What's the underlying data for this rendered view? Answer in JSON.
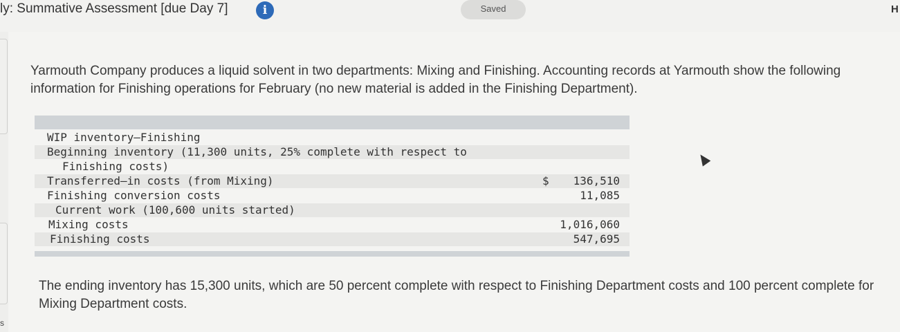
{
  "header": {
    "title": "ly: Summative Assessment [due Day 7]",
    "info_icon": "info-circle-icon",
    "saved_label": "Saved",
    "corner_letter": "H"
  },
  "sidebar": {
    "bottom_letter": "s"
  },
  "problem": {
    "intro": "Yarmouth Company produces a liquid solvent in two departments: Mixing and Finishing. Accounting records at Yarmouth show the following information for Finishing operations for February (no new material is added in the Finishing Department).",
    "outro": "The ending inventory has 15,300 units, which are 50 percent complete with respect to Finishing Department costs and 100 percent complete for Mixing Department costs."
  },
  "table": {
    "rows": [
      {
        "label": "WIP inventory–Finishing",
        "currency": "",
        "amount": ""
      },
      {
        "label": "Beginning inventory (11,300 units, 25% complete with respect to",
        "currency": "",
        "amount": ""
      },
      {
        "label": "Finishing costs)",
        "currency": "",
        "amount": ""
      },
      {
        "label": "Transferred–in costs (from Mixing)",
        "currency": "$",
        "amount": "136,510"
      },
      {
        "label": "Finishing conversion costs",
        "currency": "",
        "amount": "11,085"
      },
      {
        "label": "Current work (100,600 units started)",
        "currency": "",
        "amount": ""
      },
      {
        "label": "Mixing costs",
        "currency": "",
        "amount": "1,016,060"
      },
      {
        "label": "Finishing costs",
        "currency": "",
        "amount": "547,695"
      }
    ]
  }
}
